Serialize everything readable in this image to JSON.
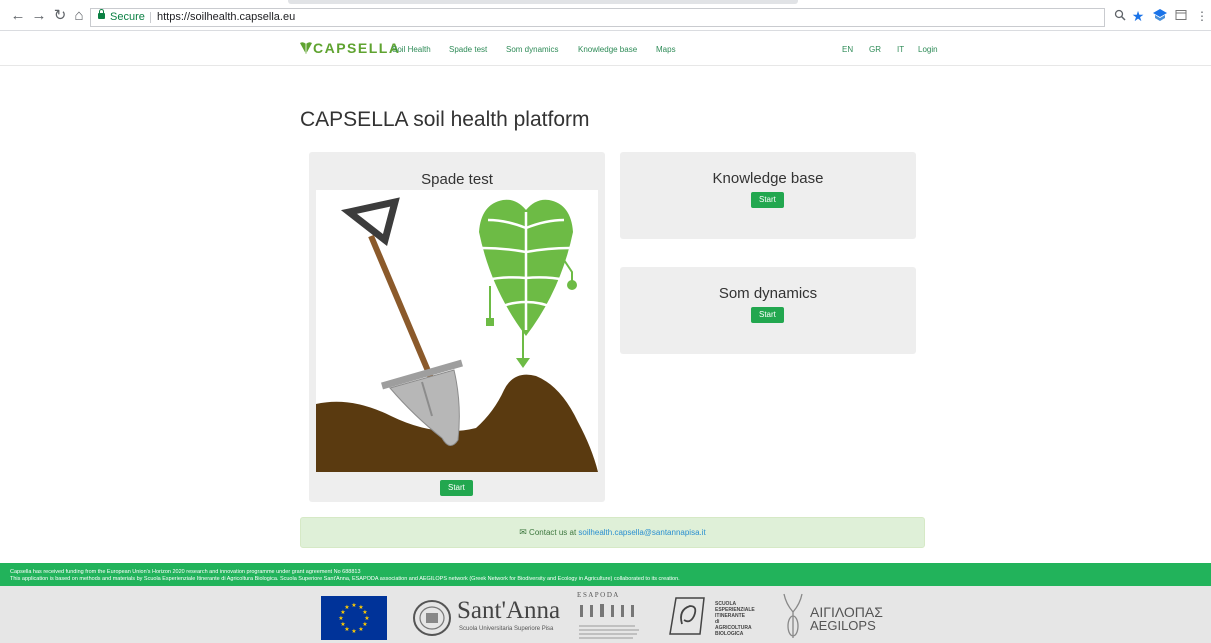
{
  "browser": {
    "nav_icons": [
      "back-icon",
      "forward-icon",
      "reload-icon",
      "home-icon"
    ],
    "secure_label": "Secure",
    "url": "https://soilhealth.capsella.eu",
    "extensions": [
      "zoom-icon",
      "bookmark-star-icon",
      "extension-icon",
      "cast-icon",
      "menu-icon"
    ]
  },
  "nav": {
    "brand": "CAPSELLA",
    "links": [
      "Soil Health",
      "Spade test",
      "Som dynamics",
      "Knowledge base",
      "Maps"
    ],
    "languages": [
      "EN",
      "GR",
      "IT"
    ],
    "login": "Login"
  },
  "page": {
    "title": "CAPSELLA soil health platform"
  },
  "cards": {
    "spade": {
      "title": "Spade test",
      "button": "Start"
    },
    "knowledge": {
      "title": "Knowledge base",
      "button": "Start"
    },
    "som": {
      "title": "Som dynamics",
      "button": "Start"
    }
  },
  "contact": {
    "prefix": "Contact us at",
    "email": "soilhealth.capsella@santannapisa.it"
  },
  "footer": {
    "funding_line1": "Capsella has received funding from the European Union's Horizon 2020 research and innovation programme under grant agreement No 688813",
    "funding_line2": "This application is based on methods and materials by Scuola Esperienziale Itinerante di Agricoltura Biologica. Scuola Superiore Sant'Anna, ESAPODA association and AEGILOPS network (Greek Network for Biodiversity and Ecology in Agriculture) collaborated to its creation.",
    "santanna_name": "Sant'Anna",
    "santanna_sub": "Scuola Universitaria Superiore Pisa",
    "esapoda": "E S A P O D A",
    "scuola_lines": [
      "SCUOLA",
      "ESPERIENZIALE",
      "ITINERANTE",
      "di",
      "AGRICOLTURA",
      "BIOLOGICA"
    ],
    "aegilops_greek": "ΑΙΓΙΛΟΠΑΣ",
    "aegilops_latin": "AEGILOPS"
  },
  "colors": {
    "brand_green": "#5fa330",
    "button_green": "#22a74f",
    "footer_green": "#22b35b",
    "soil_brown": "#5a3a10",
    "leaf_green": "#6dbb45",
    "shovel_grey": "#b7b7b7",
    "handle_brown": "#8b5a2b"
  }
}
